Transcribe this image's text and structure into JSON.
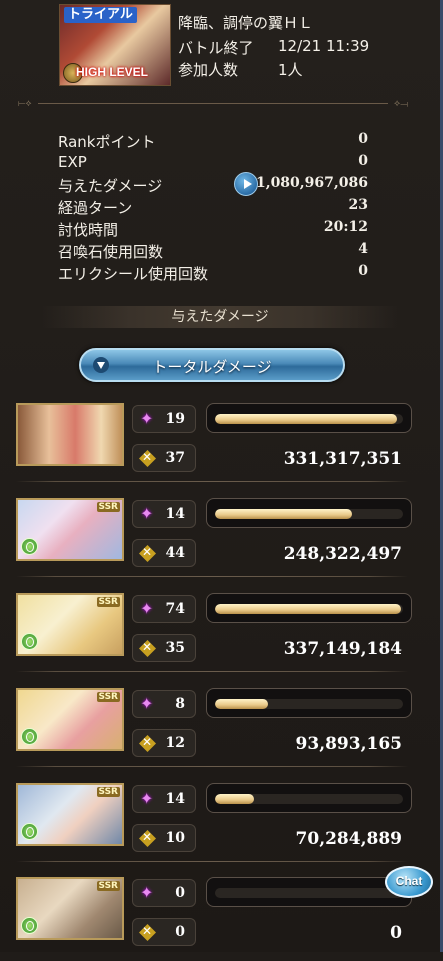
{
  "header": {
    "thumb_badge": "トライアル",
    "thumb_level": "HIGH LEVEL",
    "quest_name": "降臨、調停の翼ＨＬ",
    "battle_end_label": "バトル終了",
    "battle_end_time": "12/21 11:39",
    "participants_label": "参加人数",
    "participants_value": "1人"
  },
  "stats": [
    {
      "label": "Rankポイント",
      "value": "0"
    },
    {
      "label": "EXP",
      "value": "0"
    },
    {
      "label": "与えたダメージ",
      "value": "1,080,967,086"
    },
    {
      "label": "経過ターン",
      "value": "23"
    },
    {
      "label": "討伐時間",
      "value": "20:12"
    },
    {
      "label": "召喚石使用回数",
      "value": "4"
    },
    {
      "label": "エリクシール使用回数",
      "value": "0"
    }
  ],
  "damage_section": {
    "title": "与えたダメージ",
    "toggle_label": "トータルダメージ"
  },
  "characters": [
    {
      "star": "19",
      "x": "37",
      "damage": "331,317,351",
      "gauge_pct": 97,
      "ssr": "",
      "element": "none"
    },
    {
      "star": "14",
      "x": "44",
      "damage": "248,322,497",
      "gauge_pct": 73,
      "ssr": "SSR",
      "element": "wind"
    },
    {
      "star": "74",
      "x": "35",
      "damage": "337,149,184",
      "gauge_pct": 99,
      "ssr": "SSR",
      "element": "wind"
    },
    {
      "star": "8",
      "x": "12",
      "damage": "93,893,165",
      "gauge_pct": 28,
      "ssr": "SSR",
      "element": "wind"
    },
    {
      "star": "14",
      "x": "10",
      "damage": "70,284,889",
      "gauge_pct": 21,
      "ssr": "SSR",
      "element": "wind"
    },
    {
      "star": "0",
      "x": "0",
      "damage": "0",
      "gauge_pct": 0,
      "ssr": "SSR",
      "element": "wind"
    }
  ],
  "chat_button": "Chat",
  "colors": {
    "background": "#201c19",
    "accent_blue": "#4a8ab8",
    "gauge_fill": "#e8c888",
    "frame_gold": "#b89a5a"
  }
}
